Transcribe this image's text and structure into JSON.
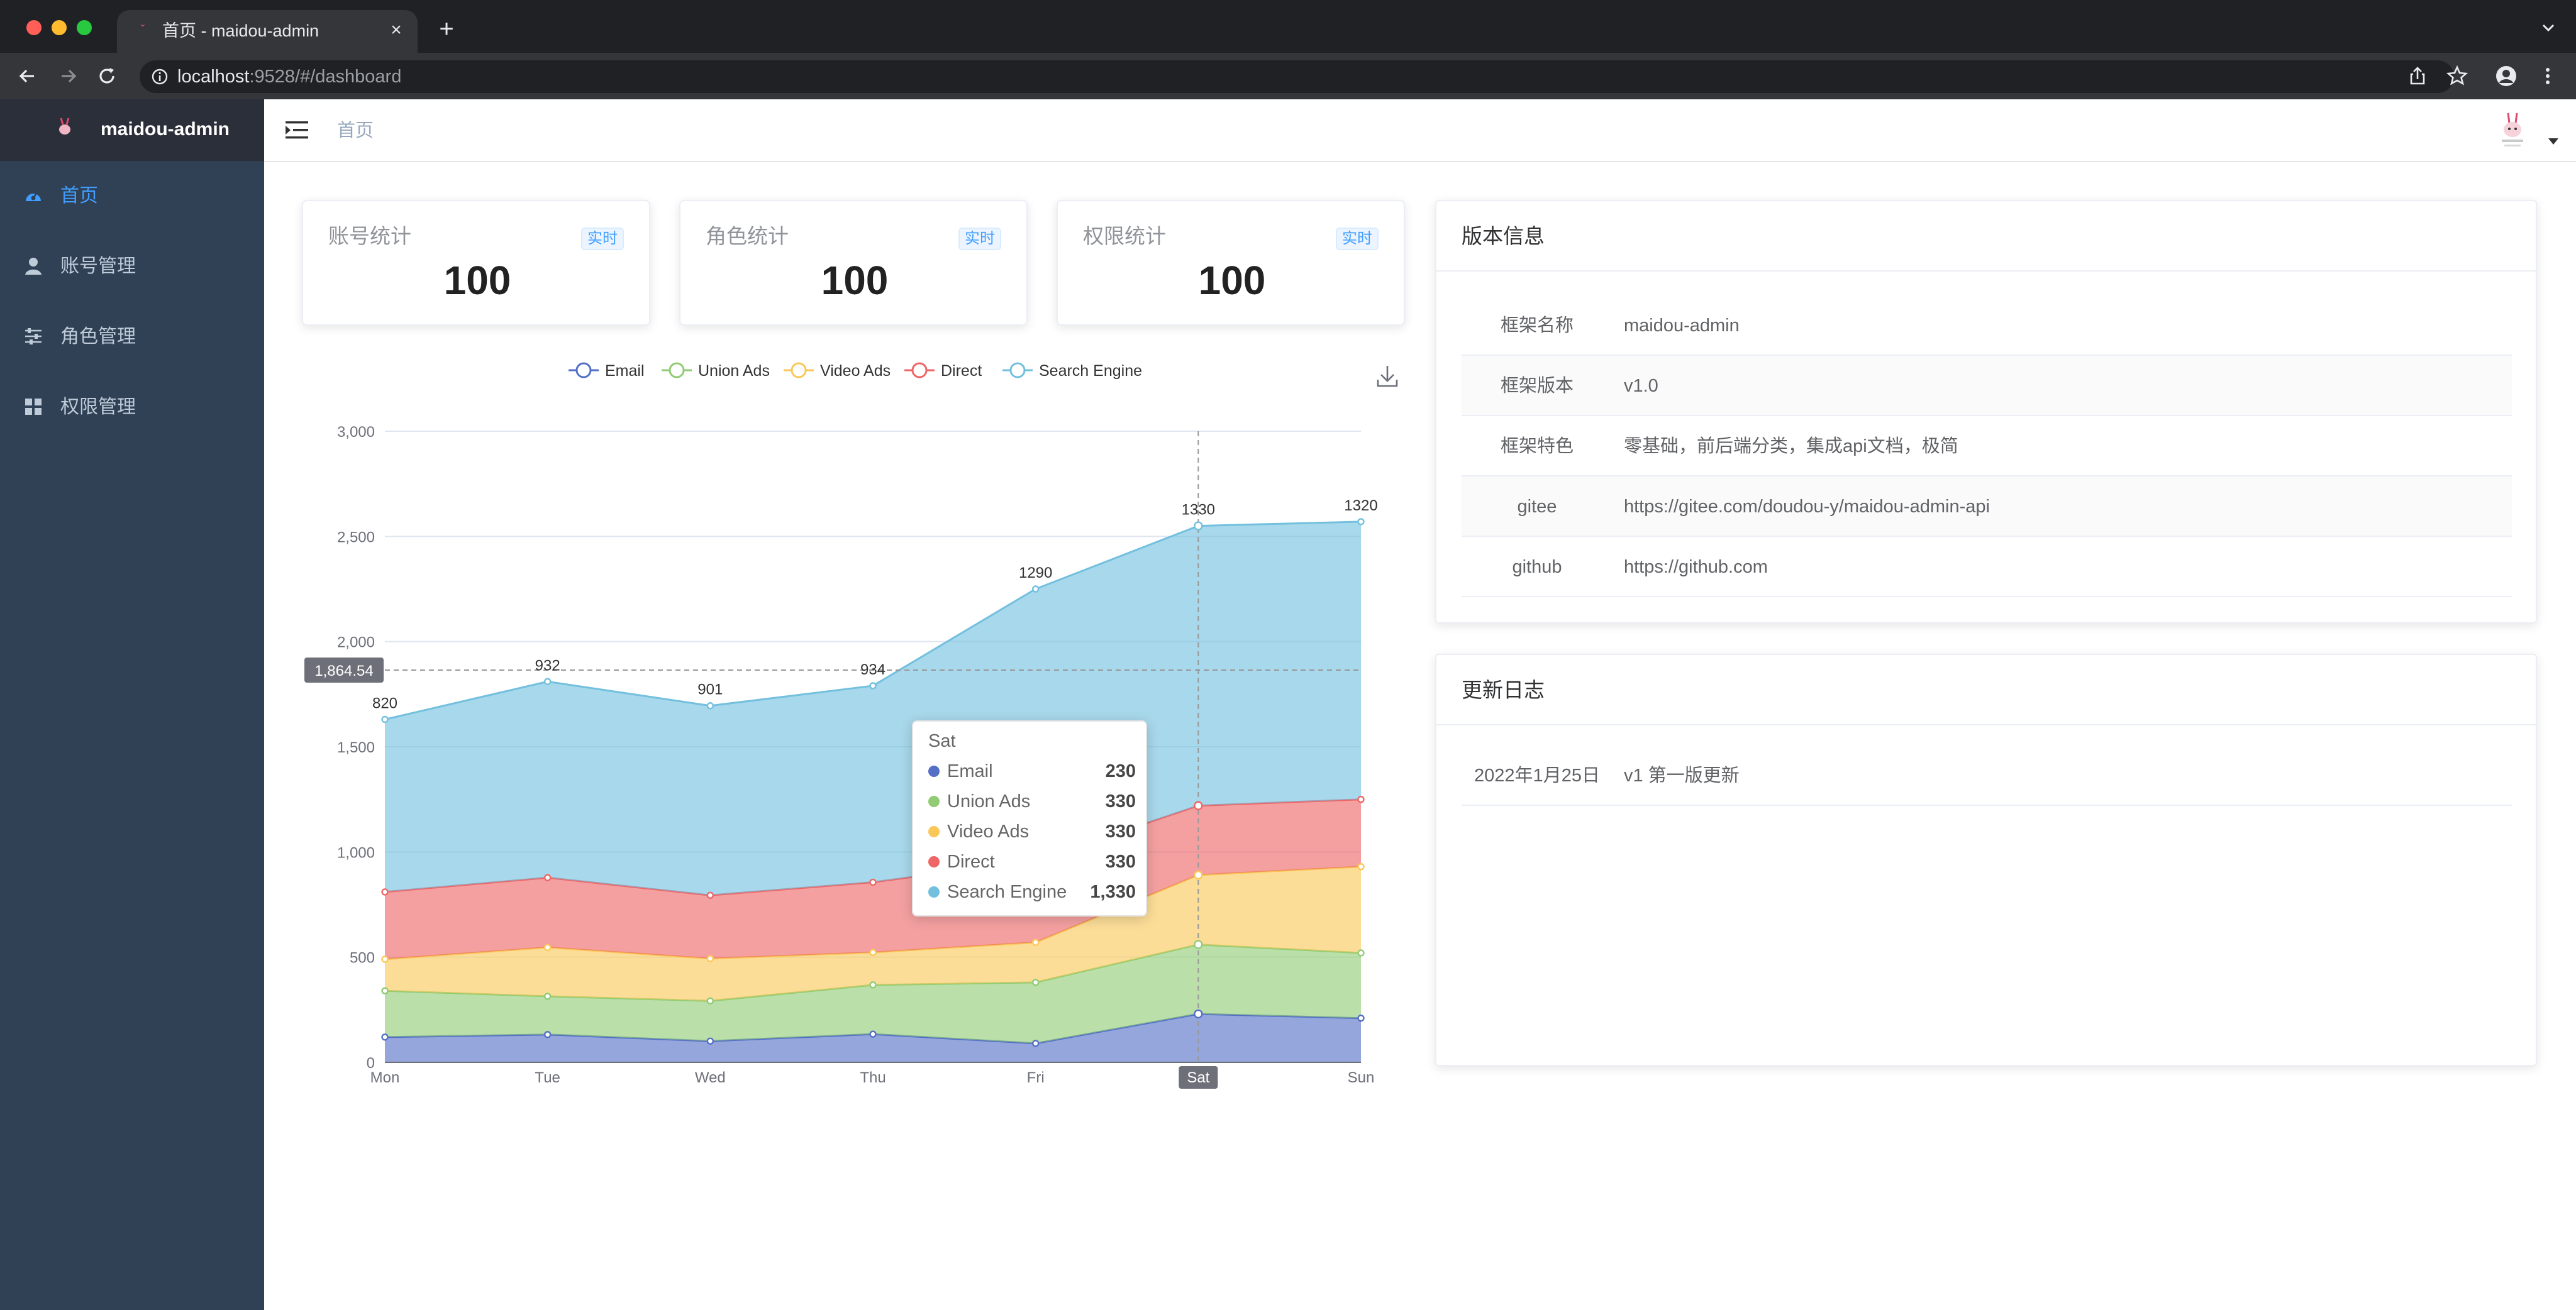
{
  "browser": {
    "tab_title": "首页 - maidou-admin",
    "url_host": "localhost",
    "url_path": ":9528/#/dashboard"
  },
  "app": {
    "logo_text": "maidou-admin",
    "breadcrumb": "首页"
  },
  "sidebar": {
    "items": [
      {
        "label": "首页",
        "icon": "dashboard-icon",
        "active": true
      },
      {
        "label": "账号管理",
        "icon": "user-icon",
        "active": false
      },
      {
        "label": "角色管理",
        "icon": "sliders-icon",
        "active": false
      },
      {
        "label": "权限管理",
        "icon": "grid-icon",
        "active": false
      }
    ]
  },
  "stats": [
    {
      "title": "账号统计",
      "badge": "实时",
      "value": "100"
    },
    {
      "title": "角色统计",
      "badge": "实时",
      "value": "100"
    },
    {
      "title": "权限统计",
      "badge": "实时",
      "value": "100"
    }
  ],
  "chart_data": {
    "type": "area",
    "stacked": true,
    "categories": [
      "Mon",
      "Tue",
      "Wed",
      "Thu",
      "Fri",
      "Sat",
      "Sun"
    ],
    "series": [
      {
        "name": "Email",
        "color": "#5470c6",
        "values": [
          120,
          132,
          101,
          134,
          90,
          230,
          210
        ]
      },
      {
        "name": "Union Ads",
        "color": "#91cc75",
        "values": [
          220,
          182,
          191,
          234,
          290,
          330,
          310
        ]
      },
      {
        "name": "Video Ads",
        "color": "#fac858",
        "values": [
          150,
          232,
          201,
          154,
          190,
          330,
          410
        ]
      },
      {
        "name": "Direct",
        "color": "#ee6666",
        "values": [
          320,
          332,
          301,
          334,
          390,
          330,
          320
        ]
      },
      {
        "name": "Search Engine",
        "color": "#73c0de",
        "values": [
          820,
          932,
          901,
          934,
          1290,
          1330,
          1320
        ]
      }
    ],
    "top_labels": [
      "820",
      "932",
      "901",
      "934",
      "1290",
      "1330",
      "1320"
    ],
    "y_ticks": [
      "0",
      "500",
      "1,000",
      "1,500",
      "2,000",
      "2,500",
      "3,000"
    ],
    "ylim": [
      0,
      3000
    ],
    "grid": true,
    "legend_position": "top",
    "axis_pointer": {
      "category": "Sat",
      "y_value": "1,864.54"
    },
    "tooltip": {
      "title": "Sat",
      "rows": [
        {
          "name": "Email",
          "value": "230",
          "color": "#5470c6"
        },
        {
          "name": "Union Ads",
          "value": "330",
          "color": "#91cc75"
        },
        {
          "name": "Video Ads",
          "value": "330",
          "color": "#fac858"
        },
        {
          "name": "Direct",
          "value": "330",
          "color": "#ee6666"
        },
        {
          "name": "Search Engine",
          "value": "1,330",
          "color": "#73c0de"
        }
      ]
    }
  },
  "version_panel": {
    "title": "版本信息",
    "rows": [
      {
        "key": "框架名称",
        "value": "maidou-admin"
      },
      {
        "key": "框架版本",
        "value": "v1.0"
      },
      {
        "key": "框架特色",
        "value": "零基础，前后端分类，集成api文档，极简"
      },
      {
        "key": "gitee",
        "value": "https://gitee.com/doudou-y/maidou-admin-api"
      },
      {
        "key": "github",
        "value": "https://github.com"
      }
    ]
  },
  "changelog_panel": {
    "title": "更新日志",
    "rows": [
      {
        "key": "2022年1月25日",
        "value": "v1 第一版更新"
      }
    ]
  }
}
